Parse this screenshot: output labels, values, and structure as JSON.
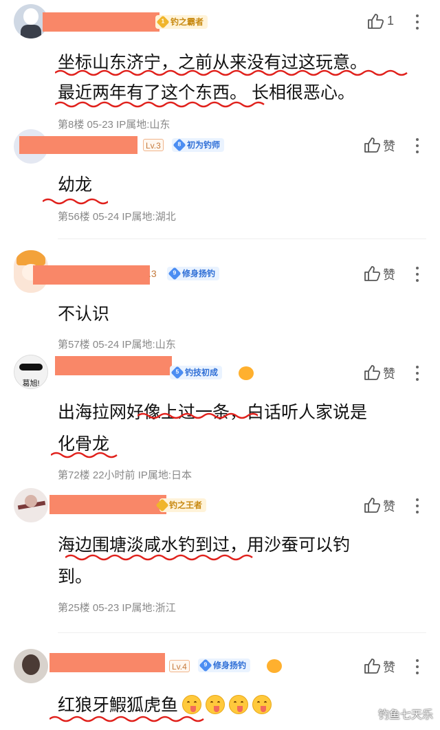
{
  "comments": [
    {
      "level": "",
      "badge": {
        "num": "1",
        "label": "钓之霸者",
        "style": "gold"
      },
      "likes": "1",
      "lines": [
        "坐标山东济宁，之前从来没有过这玩意。",
        "最近两年有了这个东西。 长相很恶心。"
      ],
      "meta": "第8楼  05-23  IP属地:山东"
    },
    {
      "level": "Lv.3",
      "badge": {
        "num": "8",
        "label": "初为钓师",
        "style": "blue"
      },
      "likes": "赞",
      "lines": [
        "幼龙"
      ],
      "meta": "第56楼  05-24  IP属地:湖北"
    },
    {
      "level": ".3",
      "badge": {
        "num": "9",
        "label": "修身扬钓",
        "style": "blue"
      },
      "likes": "赞",
      "lines": [
        "不认识"
      ],
      "meta": "第57楼  05-24  IP属地:山东"
    },
    {
      "level": "",
      "badge": {
        "num": "5",
        "label": "钓技初成",
        "style": "blue"
      },
      "likes": "赞",
      "lines": [
        "出海拉网好像上过一条，白话听人家说是",
        "化骨龙"
      ],
      "meta": "第72楼  22小时前  IP属地:日本"
    },
    {
      "level": "",
      "badge": {
        "num": "",
        "label": "钓之王者",
        "style": "gold"
      },
      "likes": "赞",
      "lines": [
        "海边围塘淡咸水钓到过，用沙蚕可以钓",
        "到。"
      ],
      "meta": "第25楼  05-23  IP属地:浙江"
    },
    {
      "level": "Lv.4",
      "badge": {
        "num": "9",
        "label": "修身扬钓",
        "style": "blue"
      },
      "likes": "赞",
      "lines": [
        "红狼牙鰕狐虎鱼"
      ],
      "meta": ""
    }
  ],
  "avatar4_text": "葛旭!",
  "watermark": "钓鱼七天乐",
  "icons": {
    "like": "thumbs-up-icon",
    "more": "more-vertical-icon",
    "emoji": "yum-face-icon"
  },
  "colors": {
    "redaction": "#f98768",
    "underline": "#e0201b",
    "badge_blue": "#2f6fd6",
    "badge_gold": "#c88a12"
  }
}
